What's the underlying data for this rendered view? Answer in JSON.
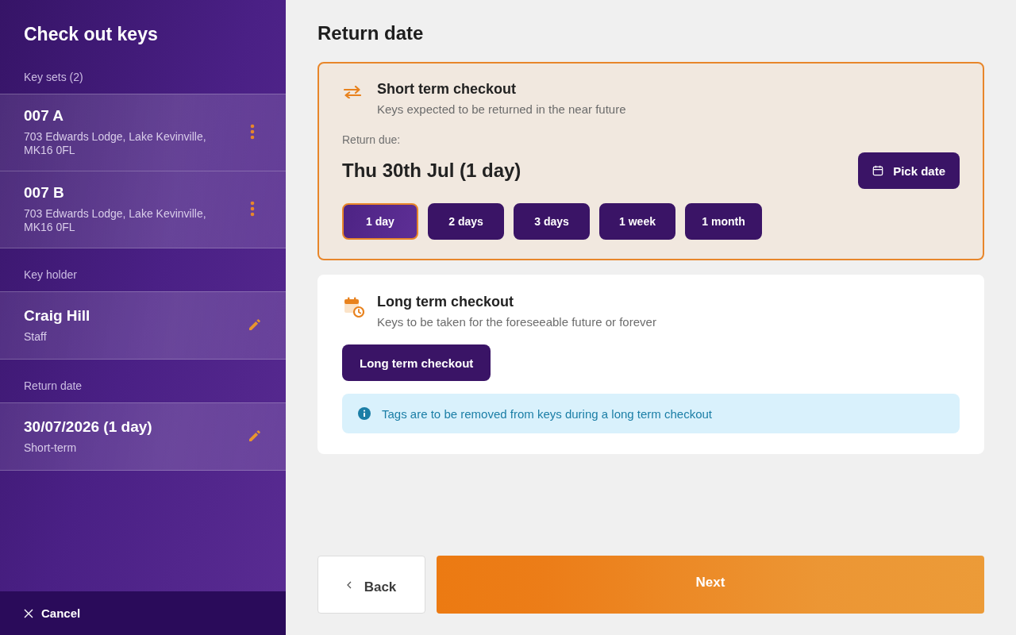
{
  "sidebar": {
    "title": "Check out keys",
    "sections": [
      {
        "heading": "Key sets (2)",
        "items": [
          {
            "title": "007 A",
            "subtitle": "703 Edwards Lodge, Lake Kevinville, MK16 0FL",
            "kind": "menu"
          },
          {
            "title": "007 B",
            "subtitle": "703 Edwards Lodge, Lake Kevinville, MK16 0FL",
            "kind": "menu"
          }
        ]
      },
      {
        "heading": "Key holder",
        "items": [
          {
            "title": "Craig Hill",
            "subtitle": "Staff",
            "kind": "edit"
          }
        ]
      },
      {
        "heading": "Return date",
        "items": [
          {
            "title": "30/07/2026 (1 day)",
            "subtitle": "Short-term",
            "kind": "edit"
          }
        ]
      }
    ],
    "cancel": "Cancel"
  },
  "main": {
    "title": "Return date",
    "options": [
      {
        "kind": "short",
        "selected": true,
        "title": "Short term checkout",
        "description": "Keys expected to be returned in the near future",
        "due_label": "Return due:",
        "due_value": "Thu 30th Jul (1 day)",
        "pick_button": "Pick date",
        "durations": [
          {
            "label": "1 day",
            "selected": true
          },
          {
            "label": "2 days",
            "selected": false
          },
          {
            "label": "3 days",
            "selected": false
          },
          {
            "label": "1 week",
            "selected": false
          },
          {
            "label": "1 month",
            "selected": false
          }
        ]
      },
      {
        "kind": "long",
        "selected": false,
        "title": "Long term checkout",
        "description": "Keys to be taken for the foreseeable future or forever",
        "button": "Long term checkout",
        "notice": "Tags are to be removed from keys during a long term checkout"
      }
    ]
  },
  "footer": {
    "back": "Back",
    "next": "Next"
  }
}
